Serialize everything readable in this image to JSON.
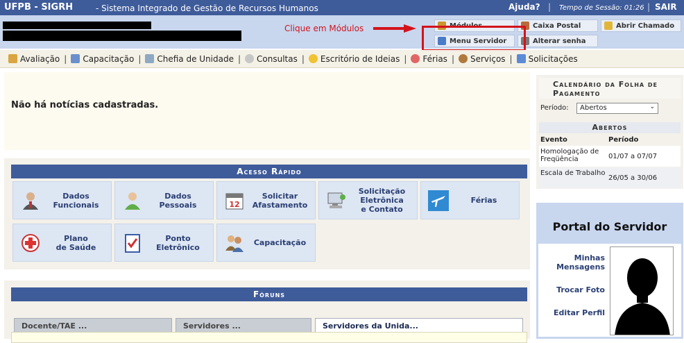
{
  "topbar": {
    "brand": "UFPB - SIGRH",
    "subtitle": "- Sistema Integrado de Gestão de Recursos Humanos",
    "help": "Ajuda?",
    "session_label": "Tempo de Sessão: 01:26",
    "logout": "SAIR"
  },
  "annotation": {
    "text": "Clique em Módulos",
    "color": "#d3121b"
  },
  "quick_buttons": {
    "modulos": "Módulos",
    "caixa_postal": "Caixa Postal",
    "abrir_chamado": "Abrir Chamado",
    "menu_servidor": "Menu Servidor",
    "alterar_senha": "Alterar senha"
  },
  "menu": {
    "items": [
      {
        "label": "Avaliação",
        "icon": "pencil-icon"
      },
      {
        "label": "Capacitação",
        "icon": "notepad-icon"
      },
      {
        "label": "Chefia de Unidade",
        "icon": "org-chart-icon"
      },
      {
        "label": "Consultas",
        "icon": "magnifier-icon"
      },
      {
        "label": "Escritório de Ideias",
        "icon": "lightbulb-icon"
      },
      {
        "label": "Férias",
        "icon": "lifebuoy-icon"
      },
      {
        "label": "Serviços",
        "icon": "person-icon"
      },
      {
        "label": "Solicitações",
        "icon": "document-icon"
      }
    ]
  },
  "news": {
    "empty_text": "Não há notícias cadastradas."
  },
  "quick_access": {
    "title": "Acesso Rápido",
    "tiles": [
      {
        "label": "Dados\nFuncionais",
        "icon": "businessman-icon"
      },
      {
        "label": "Dados\nPessoais",
        "icon": "user-icon"
      },
      {
        "label": "Solicitar\nAfastamento",
        "icon": "calendar-icon"
      },
      {
        "label": "Solicitação\nEletrônica\ne Contato",
        "icon": "computer-icon"
      },
      {
        "label": "Férias",
        "icon": "airplane-icon"
      },
      {
        "label": "Plano\nde Saúde",
        "icon": "health-cross-icon"
      },
      {
        "label": "Ponto\nEletrônico",
        "icon": "checklist-icon"
      },
      {
        "label": "Capacitação",
        "icon": "group-icon"
      }
    ]
  },
  "forums": {
    "title": "Fóruns",
    "tabs": [
      "Docente/TAE ...",
      "Servidores ...",
      "Servidores da Unida..."
    ],
    "active_tab": 2
  },
  "calendar": {
    "title": "Calendário da Folha de Pagamento",
    "period_label": "Período:",
    "period_value": "Abertos",
    "subtitle": "Abertos",
    "columns": [
      "Evento",
      "Período"
    ],
    "rows": [
      {
        "event": "Homologação de Freqüência",
        "period": "01/07 a 07/07"
      },
      {
        "event": "Escala de Trabalho",
        "period": "26/05 a 30/06"
      }
    ]
  },
  "portal": {
    "title": "Portal do Servidor",
    "links": [
      "Minhas Mensagens",
      "Trocar Foto",
      "Editar Perfil"
    ]
  },
  "colors": {
    "header_blue": "#3e5b9a",
    "light_blue": "#c8d6ee",
    "accent_red": "#d3121b"
  }
}
